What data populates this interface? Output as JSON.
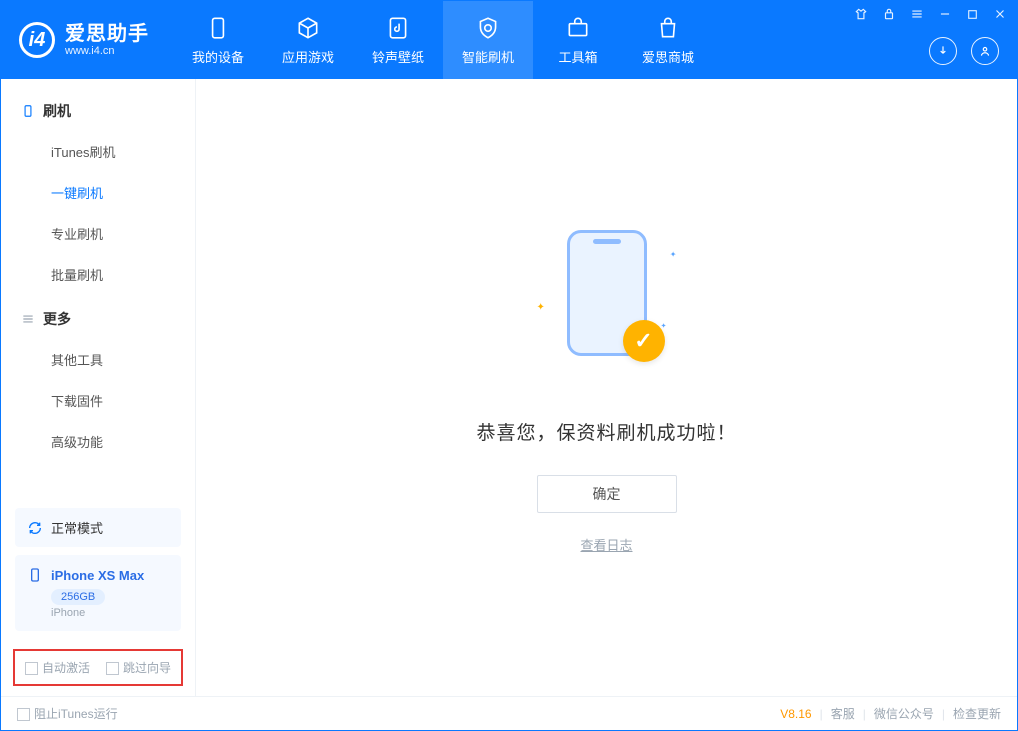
{
  "app": {
    "name": "爱思助手",
    "url": "www.i4.cn"
  },
  "tabs": [
    {
      "label": "我的设备"
    },
    {
      "label": "应用游戏"
    },
    {
      "label": "铃声壁纸"
    },
    {
      "label": "智能刷机"
    },
    {
      "label": "工具箱"
    },
    {
      "label": "爱思商城"
    }
  ],
  "sidebar": {
    "group1": {
      "title": "刷机",
      "items": [
        {
          "label": "iTunes刷机"
        },
        {
          "label": "一键刷机"
        },
        {
          "label": "专业刷机"
        },
        {
          "label": "批量刷机"
        }
      ]
    },
    "group2": {
      "title": "更多",
      "items": [
        {
          "label": "其他工具"
        },
        {
          "label": "下载固件"
        },
        {
          "label": "高级功能"
        }
      ]
    },
    "mode": "正常模式",
    "device": {
      "name": "iPhone XS Max",
      "capacity": "256GB",
      "platform": "iPhone"
    },
    "options": {
      "auto_activate": "自动激活",
      "skip_guide": "跳过向导"
    }
  },
  "main": {
    "message": "恭喜您，保资料刷机成功啦！",
    "ok": "确定",
    "viewlog": "查看日志"
  },
  "status": {
    "stop_itunes": "阻止iTunes运行",
    "version": "V8.16",
    "service": "客服",
    "wechat": "微信公众号",
    "update": "检查更新"
  }
}
